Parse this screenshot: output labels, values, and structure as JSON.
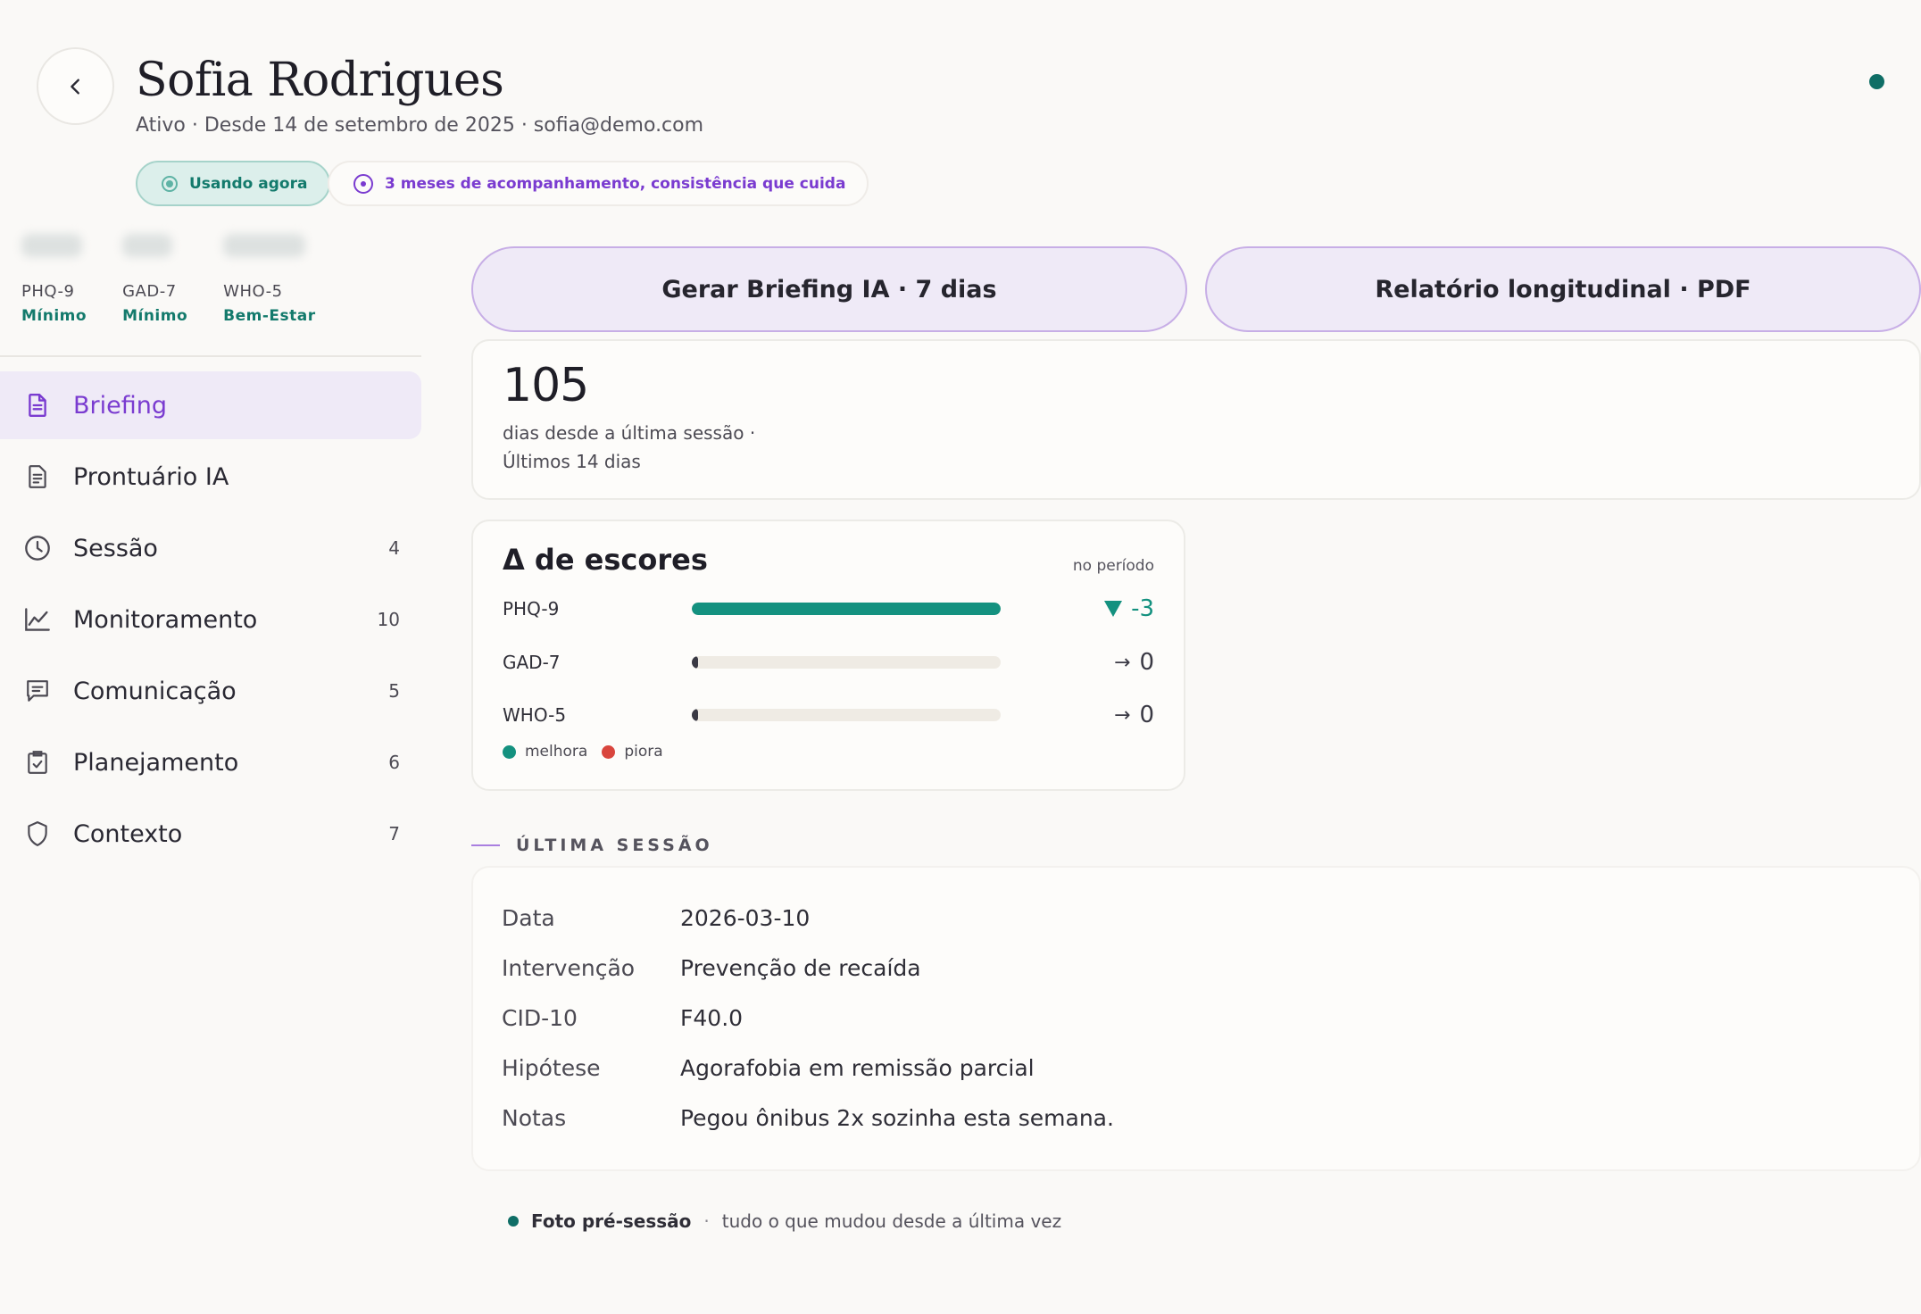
{
  "header": {
    "name": "Sofia Rodrigues",
    "subtitle": "Ativo · Desde 14 de setembro de 2025 · sofia@demo.com",
    "badge_now": "Usando agora",
    "badge_streak": "3 meses de acompanhamento, consistência que cuida",
    "colors": {
      "accent": "#7a3bd0",
      "teal": "#137a6c",
      "status": "#0f6e66"
    }
  },
  "sidebar": {
    "scores": [
      {
        "name": "PHQ-9",
        "level": "Mínimo"
      },
      {
        "name": "GAD-7",
        "level": "Mínimo"
      },
      {
        "name": "WHO-5",
        "level": "Bem-Estar"
      }
    ],
    "nav": [
      {
        "label": "Briefing",
        "count": "",
        "icon": "document-icon"
      },
      {
        "label": "Prontuário IA",
        "count": "",
        "icon": "record-icon"
      },
      {
        "label": "Sessão",
        "count": "4",
        "icon": "clock-icon"
      },
      {
        "label": "Monitoramento",
        "count": "10",
        "icon": "chart-line-icon"
      },
      {
        "label": "Comunicação",
        "count": "5",
        "icon": "message-icon"
      },
      {
        "label": "Planejamento",
        "count": "6",
        "icon": "clipboard-check-icon"
      },
      {
        "label": "Contexto",
        "count": "7",
        "icon": "shield-icon"
      }
    ]
  },
  "actions": {
    "briefing": "Gerar Briefing IA · 7 dias",
    "report": "Relatório longitudinal · PDF"
  },
  "days": {
    "number": "105",
    "line1": "dias desde a última sessão ·",
    "line2": "Últimos 14 dias"
  },
  "delta": {
    "title": "Δ de escores",
    "period": "no período",
    "rows": [
      {
        "label": "PHQ-9",
        "value": "-3",
        "arrow": "",
        "fill": 1.0,
        "trend": "improve"
      },
      {
        "label": "GAD-7",
        "value": "0",
        "arrow": "→",
        "fill": 0.0,
        "trend": "neutral"
      },
      {
        "label": "WHO-5",
        "value": "0",
        "arrow": "→",
        "fill": 0.0,
        "trend": "neutral"
      }
    ],
    "legend": {
      "improve": "melhora",
      "worsen": "piora"
    },
    "colors": {
      "improve": "#14917f",
      "worsen": "#d9453d",
      "neutral": "#3a3944"
    }
  },
  "session": {
    "section_title": "ÚLTIMA SESSÃO",
    "fields": [
      {
        "key": "Data",
        "value": "2026-03-10"
      },
      {
        "key": "Intervenção",
        "value": "Prevenção de recaída"
      },
      {
        "key": "CID-10",
        "value": "F40.0"
      },
      {
        "key": "Hipótese",
        "value": "Agorafobia em remissão parcial"
      },
      {
        "key": "Notas",
        "value": "Pegou ônibus 2x sozinha esta semana."
      }
    ]
  },
  "footer": {
    "strong": "Foto pré-sessão",
    "sep": "·",
    "rest": "tudo o que mudou desde a última vez"
  }
}
